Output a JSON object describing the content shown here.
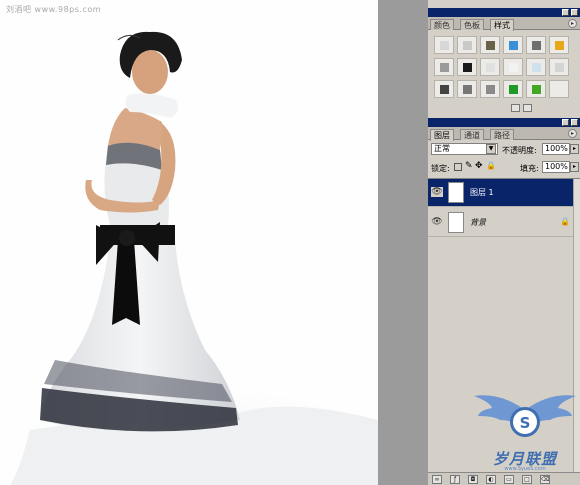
{
  "canvas": {
    "watermark": "刘酒吧 www.98ps.com"
  },
  "swatches_panel": {
    "tabs": [
      "颜色",
      "色板",
      "样式"
    ],
    "active_tab": "样式",
    "styles": [
      {
        "color": "#d7d7d7"
      },
      {
        "color": "#c9c9c9"
      },
      {
        "color": "#6b6148"
      },
      {
        "color": "#3b8fd6"
      },
      {
        "color": "#6e6e6e"
      },
      {
        "color": "#e6a81a"
      },
      {
        "color": "#9a9a9a"
      },
      {
        "color": "#1a1a1a"
      },
      {
        "color": "#e0e0e0"
      },
      {
        "color": "#f2f2f2"
      },
      {
        "color": "#cfe1ee"
      },
      {
        "color": "#d4d4d4"
      },
      {
        "color": "#444444"
      },
      {
        "color": "#777777"
      },
      {
        "color": "#8a8a8a"
      },
      {
        "color": "#1f9a24"
      },
      {
        "color": "#3fa824"
      },
      {
        "color": "#ecebe8"
      }
    ]
  },
  "layers_panel": {
    "tabs": [
      "图层",
      "通道",
      "路径"
    ],
    "active_tab": "图层",
    "blend_mode": "正常",
    "opacity_label": "不透明度:",
    "opacity_value": "100%",
    "lock_label": "锁定:",
    "fill_label": "填充:",
    "fill_value": "100%",
    "layers": [
      {
        "name": "图层 1",
        "selected": true,
        "locked": false
      },
      {
        "name": "背景",
        "selected": false,
        "locked": true
      }
    ]
  },
  "logo": {
    "text": "岁月联盟",
    "letter": "S",
    "url": "www.SyueS.com"
  },
  "colors": {
    "panel_bg": "#d4d0c8",
    "titlebar": "#0a246a",
    "selection": "#0a246a",
    "logo_blue": "#3f6fb0"
  }
}
